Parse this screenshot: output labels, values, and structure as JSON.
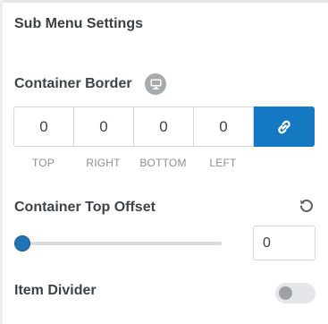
{
  "section": {
    "title": "Sub Menu Settings"
  },
  "container_border": {
    "label": "Container Border",
    "device_icon": "desktop-icon",
    "values": [
      "0",
      "0",
      "0",
      "0"
    ],
    "labels": [
      "TOP",
      "RIGHT",
      "BOTTOM",
      "LEFT"
    ],
    "link_icon": "link-icon",
    "link_color": "#1578c2"
  },
  "container_top_offset": {
    "label": "Container Top Offset",
    "reset_icon": "reset-icon",
    "slider_value": 0,
    "input_value": "0"
  },
  "item_divider": {
    "label": "Item Divider",
    "enabled": false
  }
}
